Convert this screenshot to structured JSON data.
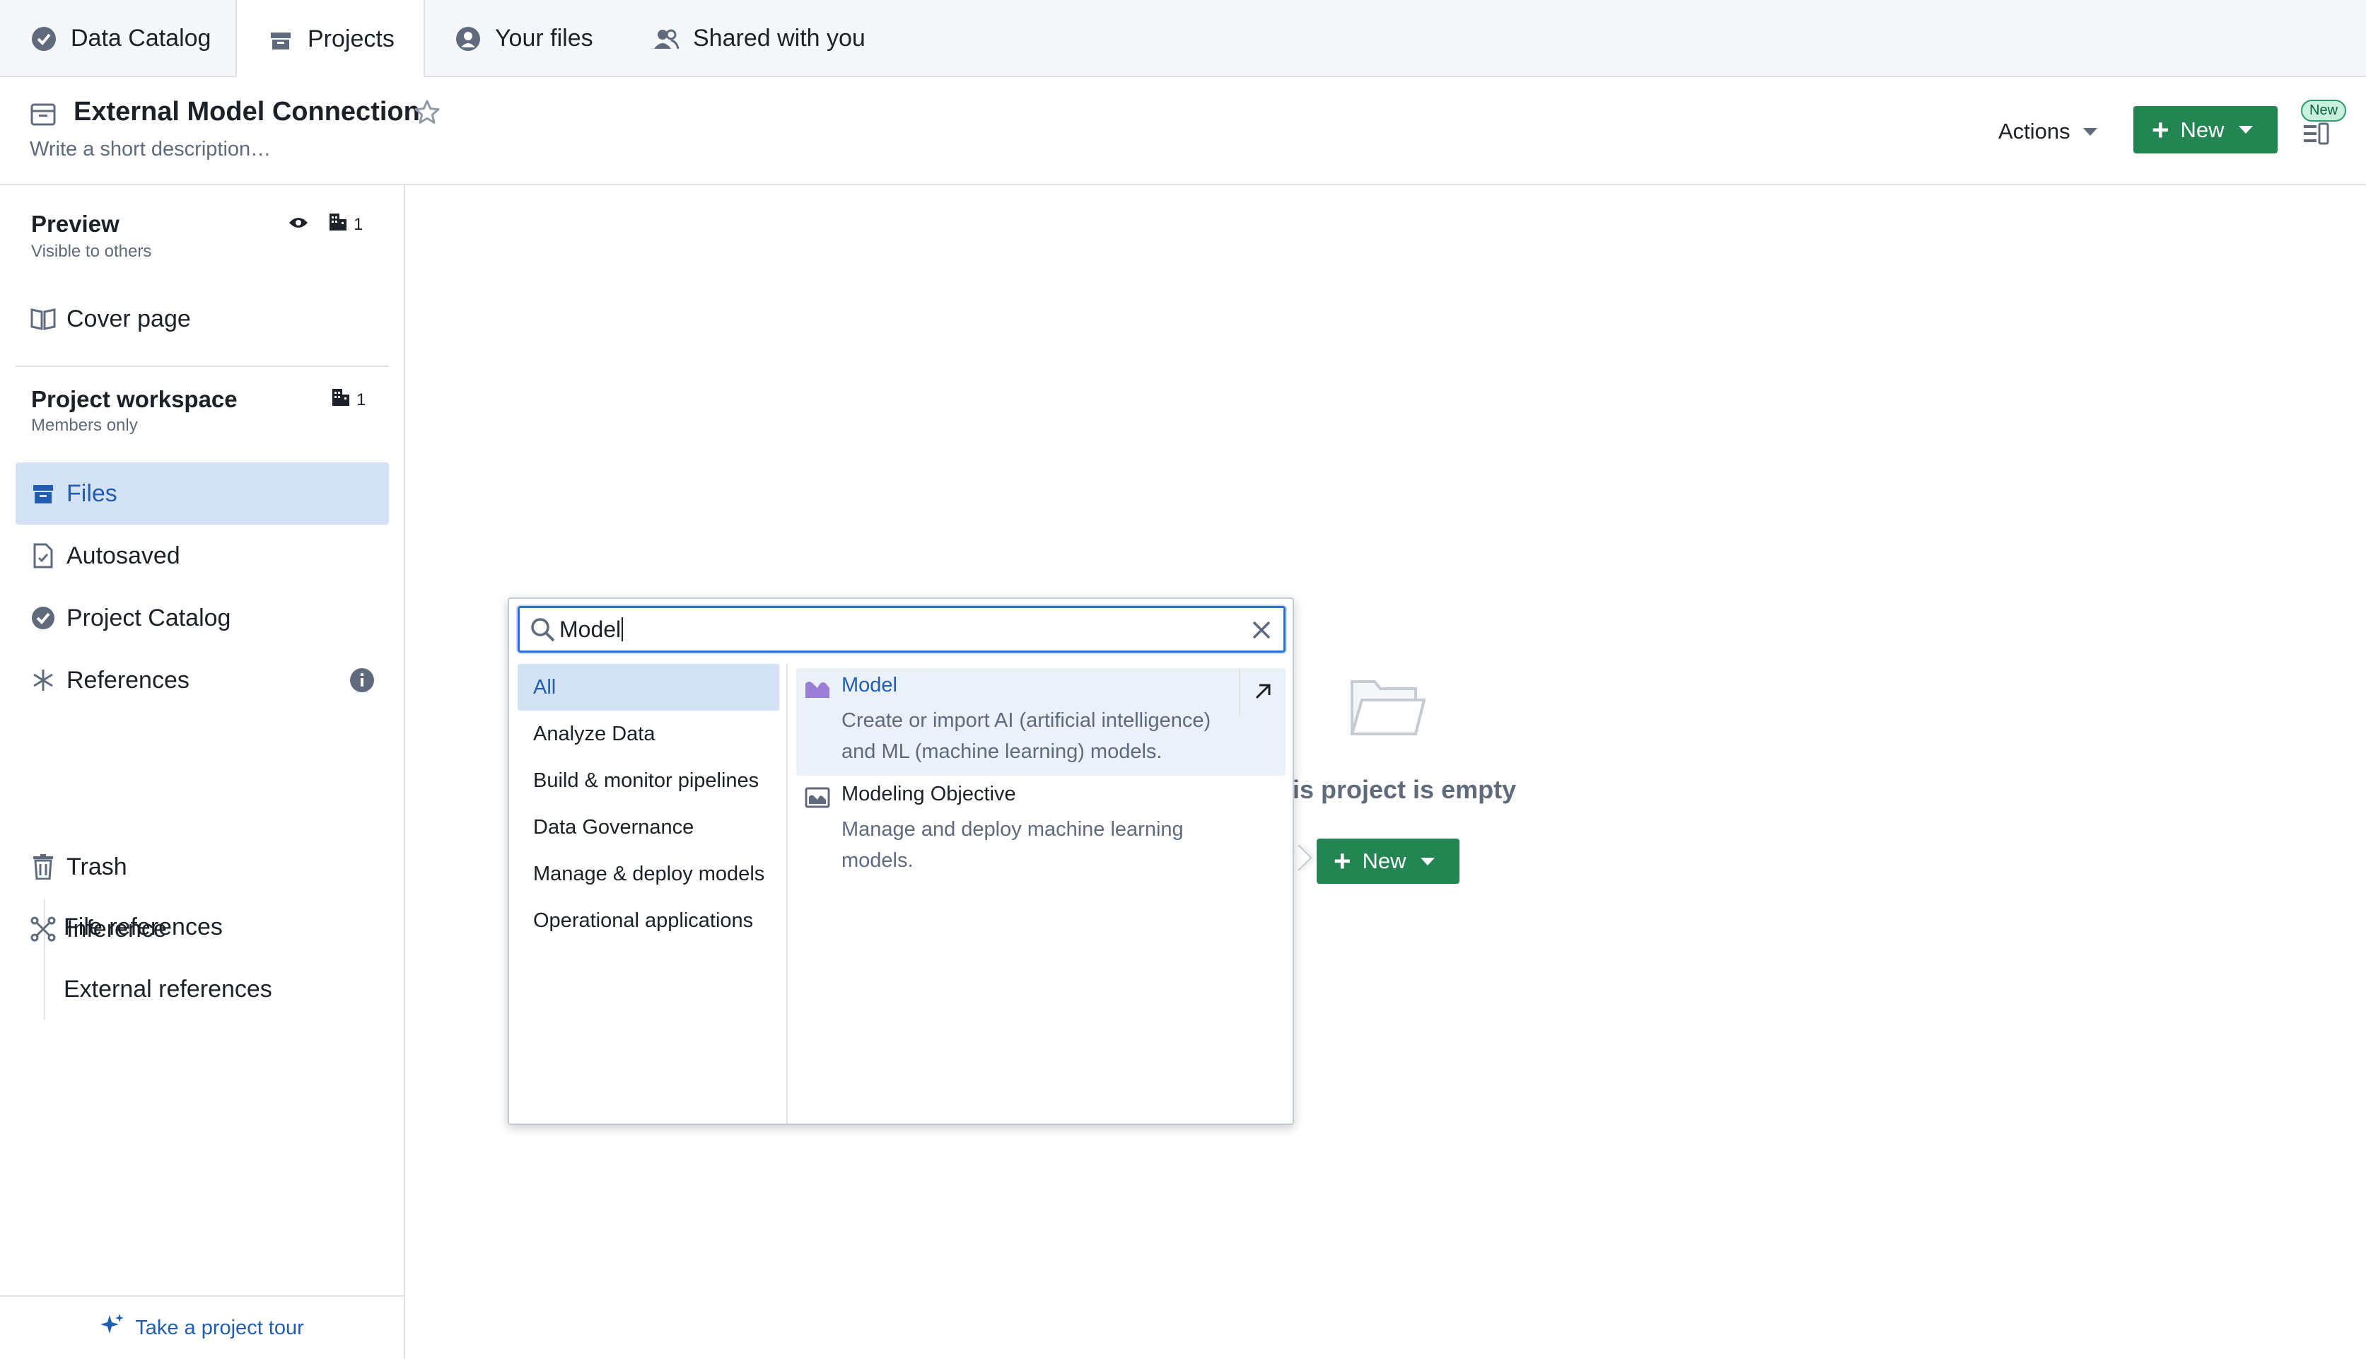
{
  "tabs": [
    {
      "label": "Data Catalog",
      "icon": "catalog-check-icon"
    },
    {
      "label": "Projects",
      "icon": "projects-box-icon"
    },
    {
      "label": "Your files",
      "icon": "user-files-icon"
    },
    {
      "label": "Shared with you",
      "icon": "shared-people-icon"
    }
  ],
  "header": {
    "title": "External Model Connection",
    "description": "Write a short description…",
    "actions_label": "Actions",
    "new_label": "New",
    "new_badge": "New"
  },
  "sidebar": {
    "preview": {
      "title": "Preview",
      "subtitle": "Visible to others",
      "count": "1"
    },
    "cover_page": "Cover page",
    "workspace": {
      "title": "Project workspace",
      "subtitle": "Members only",
      "count": "1"
    },
    "items": {
      "files": "Files",
      "autosaved": "Autosaved",
      "project_catalog": "Project Catalog",
      "references": "References",
      "file_references": "File references",
      "external_references": "External references",
      "trash": "Trash",
      "inference": "Inference"
    },
    "tour": "Take a project tour"
  },
  "empty_state": {
    "text": "is project is empty",
    "new_label": "New"
  },
  "popover": {
    "search_value": "Model",
    "categories": [
      "All",
      "Analyze Data",
      "Build & monitor pipelines",
      "Data Governance",
      "Manage & deploy models",
      "Operational applications"
    ],
    "results": [
      {
        "title": "Model",
        "description": "Create or import AI (artificial intelligence) and ML (machine learning) models."
      },
      {
        "title": "Modeling Objective",
        "description": "Manage and deploy machine learning models."
      }
    ]
  },
  "colors": {
    "accent_blue": "#215db0",
    "selected_bg": "#d3e2f5",
    "primary_green": "#238551",
    "model_purple": "#9a7ed6"
  }
}
